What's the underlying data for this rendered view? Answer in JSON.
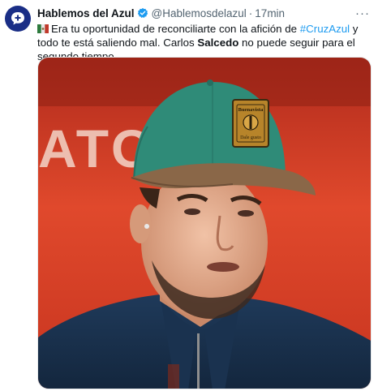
{
  "author": {
    "name": "Hablemos del Azul",
    "handle": "@Hablemosdelazul",
    "separator": "·",
    "time": "17min",
    "more_label": "···"
  },
  "tweet": {
    "text_part1": "Era tu oportunidad de reconciliarte con la afición de ",
    "hashtag": "#CruzAzul",
    "text_part2": " y todo te está saliendo mal. Carlos ",
    "bold_name": "Salcedo",
    "text_part3": " no puede seguir para el segundo tiempo."
  },
  "media": {
    "background_text": "ATO DE",
    "cap_patch_text": "Buenavista",
    "cap_patch_sub": "Dale gusto"
  },
  "icons": {
    "avatar": "chat-plus-icon",
    "verified": "verified-badge-icon",
    "flag": "mexico-flag-icon"
  },
  "colors": {
    "avatar_bg": "#1a2e86",
    "verified": "#1d9bf0",
    "hashtag": "#1d9bf0",
    "secondary_text": "#536471",
    "photo_bg": "#d23a23"
  }
}
